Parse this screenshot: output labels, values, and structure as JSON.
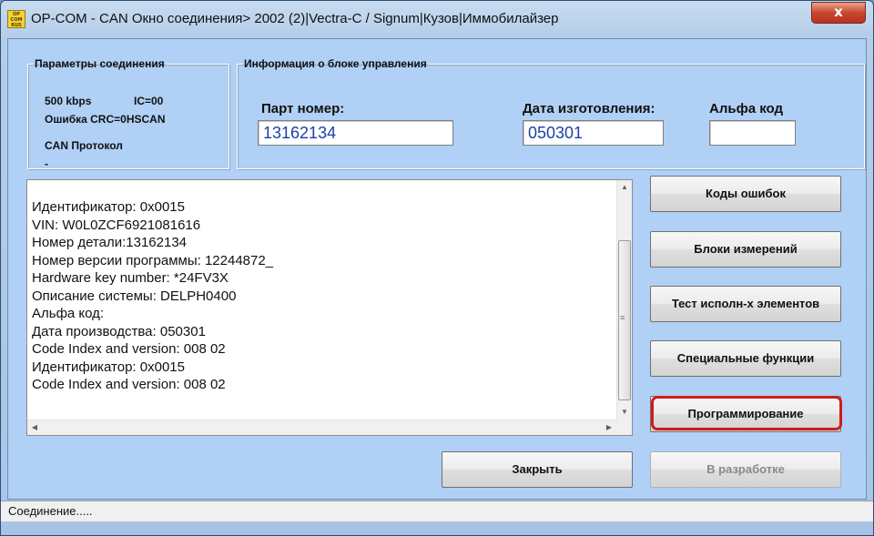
{
  "window": {
    "app_icon_text": "OP COM RUS",
    "title": "OP-COM - CAN Окно соединения> 2002 (2)|Vectra-C / Signum|Кузов|Иммобилайзер",
    "close_glyph": "x"
  },
  "connection": {
    "legend": "Параметры соединения",
    "speed": "500 kbps",
    "ic": "IC=00",
    "crc_error": "Ошибка CRC=0HSCAN",
    "protocol": "CAN Протокол",
    "protocol_value": "-"
  },
  "info": {
    "legend": "Информация о блоке управления",
    "part_label": "Парт номер:",
    "part_value": "13162134",
    "date_label": "Дата изготовления:",
    "date_value": "050301",
    "alpha_label": "Альфа код",
    "alpha_value": ""
  },
  "log": {
    "lines": [
      "Идентификатор: 0x0015",
      "VIN: W0L0ZCF6921081616",
      "Номер детали:13162134",
      "Номер версии программы: 12244872_",
      "Hardware key number: *24FV3X",
      "Описание системы: DELPH0400",
      "Альфа код:",
      "Дата производства: 050301",
      "Code Index and version: 008 02",
      "Идентификатор: 0x0015",
      "Code Index and version: 008 02"
    ]
  },
  "buttons": {
    "error_codes": "Коды ошибок",
    "measurement_blocks": "Блоки измерений",
    "actuator_test": "Тест исполн-х элементов",
    "special_functions": "Специальные функции",
    "programming": "Программирование",
    "close": "Закрыть",
    "in_development": "В разработке"
  },
  "status": {
    "text": "Соединение....."
  },
  "colors": {
    "client_bg": "#b0d0f6",
    "field_text": "#1d3fa8",
    "highlight": "#d21b1b"
  }
}
